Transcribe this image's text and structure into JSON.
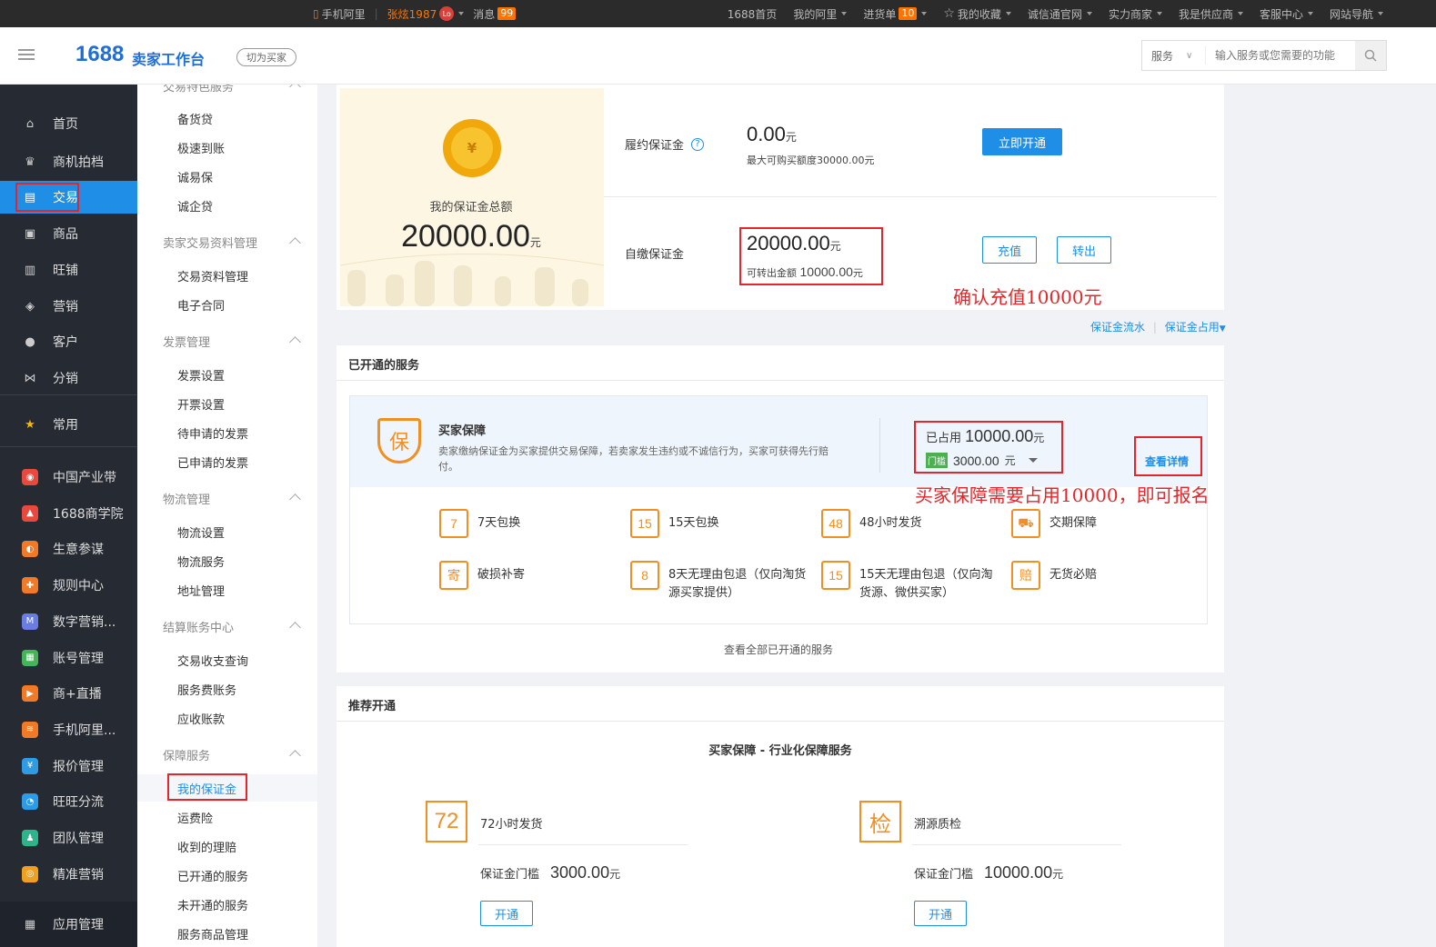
{
  "topbar": {
    "mobile": "手机阿里",
    "user": "张炫1987",
    "avatar": "Lo",
    "messages": "消息",
    "messages_count": "99",
    "links": [
      {
        "label": "1688首页",
        "caret": false
      },
      {
        "label": "我的阿里",
        "caret": true
      },
      {
        "label": "进货单",
        "caret": true,
        "badge": "10"
      },
      {
        "label": "我的收藏",
        "caret": true,
        "star": true
      },
      {
        "label": "诚信通官网",
        "caret": true
      },
      {
        "label": "实力商家",
        "caret": true
      },
      {
        "label": "我是供应商",
        "caret": true
      },
      {
        "label": "客服中心",
        "caret": true
      },
      {
        "label": "网站导航",
        "caret": true
      }
    ]
  },
  "header": {
    "logo_num": "1688",
    "logo_text": "卖家工作台",
    "switch_label": "切为买家",
    "search_select": "服务",
    "search_placeholder": "输入服务或您需要的功能"
  },
  "leftnav": {
    "items": [
      {
        "label": "首页",
        "icon": "home-icon",
        "glyph": "⌂"
      },
      {
        "label": "商机拍档",
        "icon": "crown-icon",
        "glyph": "♛"
      },
      {
        "label": "交易",
        "icon": "clipboard-icon",
        "glyph": "▤"
      },
      {
        "label": "商品",
        "icon": "box-icon",
        "glyph": "▣"
      },
      {
        "label": "旺铺",
        "icon": "shop-icon",
        "glyph": "▥"
      },
      {
        "label": "营销",
        "icon": "tag-icon",
        "glyph": "◈"
      },
      {
        "label": "客户",
        "icon": "user-icon",
        "glyph": "●"
      },
      {
        "label": "分销",
        "icon": "share-icon",
        "glyph": "⋈"
      },
      {
        "label": "常用",
        "icon": "star-icon",
        "glyph": "★"
      }
    ],
    "apps": [
      {
        "label": "中国产业带",
        "icon": "location-icon",
        "color": "#e8483d",
        "glyph": "◉"
      },
      {
        "label": "1688商学院",
        "icon": "school-icon",
        "color": "#e8483d",
        "glyph": "▲"
      },
      {
        "label": "生意参谋",
        "icon": "compass-icon",
        "color": "#f07a28",
        "glyph": "◐"
      },
      {
        "label": "规则中心",
        "icon": "rule-icon",
        "color": "#f07a28",
        "glyph": "✚"
      },
      {
        "label": "数字营销...",
        "icon": "mail-icon",
        "color": "#6a7de0",
        "glyph": "M"
      },
      {
        "label": "账号管理",
        "icon": "account-icon",
        "color": "#46b35a",
        "glyph": "▦"
      },
      {
        "label": "商+直播",
        "icon": "live-icon",
        "color": "#f07a28",
        "glyph": "▶"
      },
      {
        "label": "手机阿里...",
        "icon": "mobile-icon",
        "color": "#f07a28",
        "glyph": "≋"
      },
      {
        "label": "报价管理",
        "icon": "quote-icon",
        "color": "#2d9be5",
        "glyph": "¥"
      },
      {
        "label": "旺旺分流",
        "icon": "wangwang-icon",
        "color": "#2d9be5",
        "glyph": "◔"
      },
      {
        "label": "团队管理",
        "icon": "team-icon",
        "color": "#2fb38a",
        "glyph": "♟"
      },
      {
        "label": "精准营销",
        "icon": "target-icon",
        "color": "#f0a020",
        "glyph": "◎"
      }
    ],
    "bottom": {
      "label": "应用管理",
      "icon": "grid-icon",
      "glyph": "▦"
    }
  },
  "subnav": {
    "top_group": "交易特色服务",
    "groups": [
      {
        "title": "",
        "items": [
          "备货贷",
          "极速到账",
          "诚易保",
          "诚企贷"
        ]
      },
      {
        "title": "卖家交易资料管理",
        "items": [
          "交易资料管理",
          "电子合同"
        ]
      },
      {
        "title": "发票管理",
        "items": [
          "发票设置",
          "开票设置",
          "待申请的发票",
          "已申请的发票"
        ]
      },
      {
        "title": "物流管理",
        "items": [
          "物流设置",
          "物流服务",
          "地址管理"
        ]
      },
      {
        "title": "结算账务中心",
        "items": [
          "交易收支查询",
          "服务费账务",
          "应收账款"
        ]
      },
      {
        "title": "保障服务",
        "items": [
          "我的保证金",
          "运费险",
          "收到的理赔",
          "已开通的服务",
          "未开通的服务",
          "服务商品管理"
        ]
      }
    ]
  },
  "deposit": {
    "total_label": "我的保证金总额",
    "total_amount": "20000.00",
    "unit": "元",
    "fulfill_label": "履约保证金",
    "fulfill_amount": "0.00",
    "fulfill_sub": "最大可购买额度30000.00元",
    "activate_label": "立即开通",
    "self_label": "自缴保证金",
    "self_amount": "20000.00",
    "self_sub_label": "可转出金额",
    "self_sub_amount": "10000.00",
    "recharge_label": "充值",
    "transfer_label": "转出",
    "annotation": "确认充值10000元",
    "flow_link": "保证金流水",
    "occupy_link": "保证金占用"
  },
  "opened": {
    "title": "已开通的服务",
    "service_name": "买家保障",
    "service_desc": "卖家缴纳保证金为买家提供交易保障，若卖家发生违约或不诚信行为，买家可获得先行赔付。",
    "shield_glyph": "保",
    "occupied_label": "已占用",
    "occupied_amount": "10000.00",
    "threshold_tag": "门槛",
    "threshold_amount": "3000.00",
    "detail_link": "查看详情",
    "annotation": "买家保障需要占用10000，即可报名",
    "features": [
      {
        "icon": "7",
        "label": "7天包换",
        "name": "seven-day-exchange-icon"
      },
      {
        "icon": "15",
        "label": "15天包换",
        "name": "fifteen-day-exchange-icon"
      },
      {
        "icon": "48",
        "label": "48小时发货",
        "name": "ship-48h-icon"
      },
      {
        "icon": "⛟",
        "label": "交期保障",
        "name": "truck-icon"
      },
      {
        "icon": "寄",
        "label": "破损补寄",
        "name": "reship-icon"
      },
      {
        "icon": "8",
        "label": "8天无理由包退（仅向淘货源买家提供）",
        "name": "eight-day-return-icon"
      },
      {
        "icon": "15",
        "label": "15天无理由包退（仅向淘货源、微供买家）",
        "name": "fifteen-day-return-icon"
      },
      {
        "icon": "赔",
        "label": "无货必赔",
        "name": "compensation-icon"
      }
    ],
    "view_all": "查看全部已开通的服务"
  },
  "recommend": {
    "title": "推荐开通",
    "subtitle": "买家保障 - 行业化保障服务",
    "items": [
      {
        "icon": "72",
        "name": "72小时发货",
        "threshold_label": "保证金门槛",
        "amount": "3000.00",
        "unit": "元",
        "button": "开通"
      },
      {
        "icon": "检",
        "name": "溯源质检",
        "threshold_label": "保证金门槛",
        "amount": "10000.00",
        "unit": "元",
        "button": "开通"
      }
    ]
  }
}
